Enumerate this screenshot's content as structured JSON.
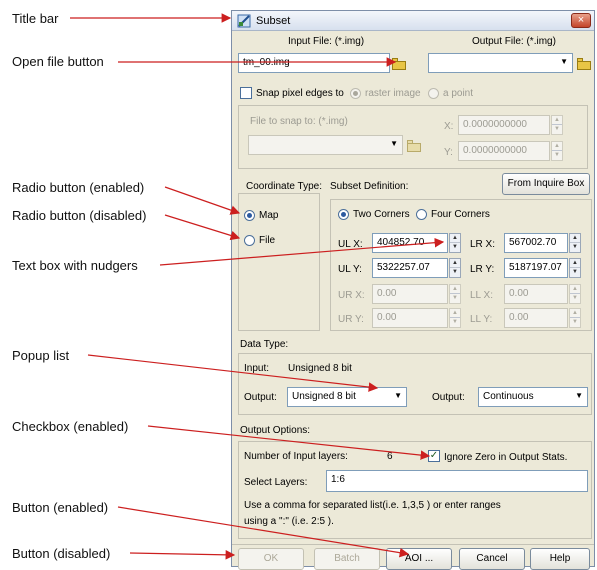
{
  "annotations": {
    "title_bar": "Title bar",
    "open_file_button": "Open file button",
    "radio_enabled": "Radio button (enabled)",
    "radio_disabled": "Radio button (disabled)",
    "textbox_nudgers": "Text box with nudgers",
    "popup_list": "Popup list",
    "checkbox_enabled": "Checkbox (enabled)",
    "button_enabled": "Button (enabled)",
    "button_disabled": "Button (disabled)"
  },
  "dialog": {
    "title": "Subset",
    "close_glyph": "×",
    "input_file_label": "Input File: (*.img)",
    "output_file_label": "Output File: (*.img)",
    "input_file_value": "tm_00.img",
    "output_file_value": "",
    "snap_label": "Snap pixel edges to",
    "raster_image_label": "raster image",
    "a_point_label": "a point",
    "file_to_snap_label": "File to snap to: (*.img)",
    "snap_x_label": "X:",
    "snap_y_label": "Y:",
    "snap_x_value": "0.0000000000",
    "snap_y_value": "0.0000000000",
    "coordinate_type_label": "Coordinate Type:",
    "map_label": "Map",
    "file_label": "File",
    "subset_definition_label": "Subset Definition:",
    "from_inquire_box": "From Inquire Box",
    "two_corners": "Two Corners",
    "four_corners": "Four Corners",
    "ulx_label": "UL X:",
    "uly_label": "UL Y:",
    "lrx_label": "LR X:",
    "lry_label": "LR Y:",
    "urx_label": "UR X:",
    "ury_label": "UR Y:",
    "llx_label": "LL X:",
    "lly_label": "LL Y:",
    "ulx": "404852.70",
    "uly": "5322257.07",
    "lrx": "567002.70",
    "lry": "5187197.07",
    "urx": "0.00",
    "ury": "0.00",
    "llx": "0.00",
    "lly": "0.00",
    "data_type_label": "Data Type:",
    "input_label": "Input:",
    "input_type": "Unsigned 8 bit",
    "output_label_left": "Output:",
    "output_type": "Unsigned 8 bit",
    "output_label_right": "Output:",
    "output_mode": "Continuous",
    "output_options_label": "Output Options:",
    "num_layers_label": "Number of Input layers:",
    "num_layers_value": "6",
    "ignore_zero_label": "Ignore Zero in Output Stats.",
    "select_layers_label": "Select Layers:",
    "select_layers_value": "1:6",
    "help_line1": "Use a comma for separated list(i.e. 1,3,5 ) or enter ranges",
    "help_line2": "using a \":\" (i.e. 2:5 ).",
    "ok": "OK",
    "batch": "Batch",
    "aoi": "AOI ...",
    "cancel": "Cancel",
    "help": "Help"
  }
}
